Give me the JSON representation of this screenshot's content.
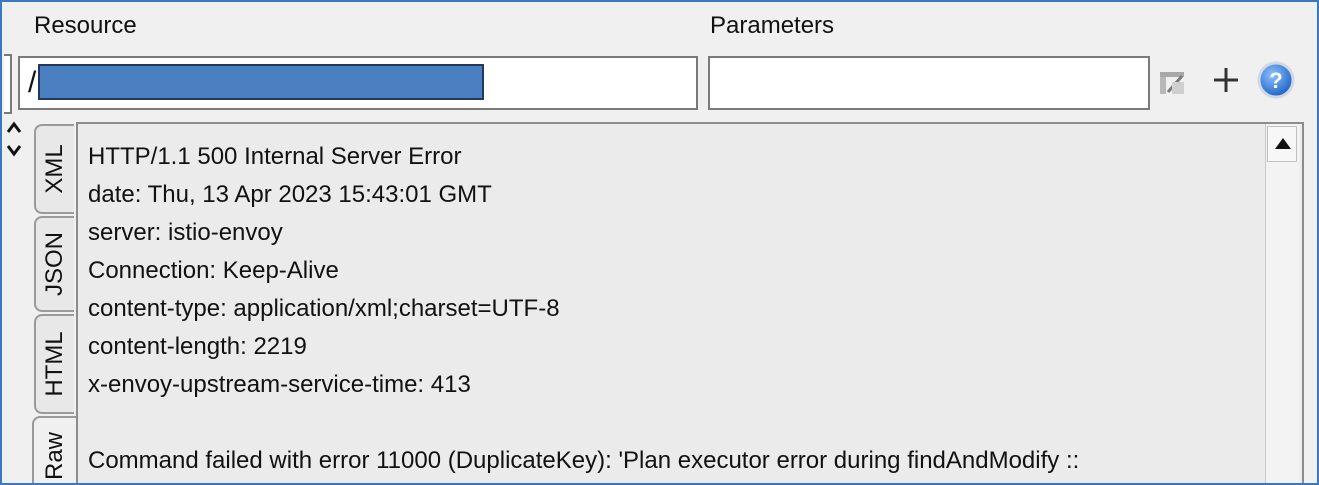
{
  "resource": {
    "label": "Resource",
    "value": "/"
  },
  "parameters": {
    "label": "Parameters",
    "value": ""
  },
  "toolbar": {
    "icons": [
      "edit-params-icon",
      "add-icon",
      "help-icon"
    ]
  },
  "tabs": [
    {
      "label": "XML",
      "active": false
    },
    {
      "label": "JSON",
      "active": false
    },
    {
      "label": "HTML",
      "active": false
    },
    {
      "label": "Raw",
      "active": true
    }
  ],
  "response": {
    "lines": [
      "HTTP/1.1 500 Internal Server Error",
      "date: Thu, 13 Apr 2023 15:43:01 GMT",
      "server: istio-envoy",
      "Connection: Keep-Alive",
      "content-type: application/xml;charset=UTF-8",
      "content-length: 2219",
      "x-envoy-upstream-service-time: 413",
      "",
      "Command failed with error 11000 (DuplicateKey): 'Plan executor error during findAndModify ::"
    ]
  }
}
